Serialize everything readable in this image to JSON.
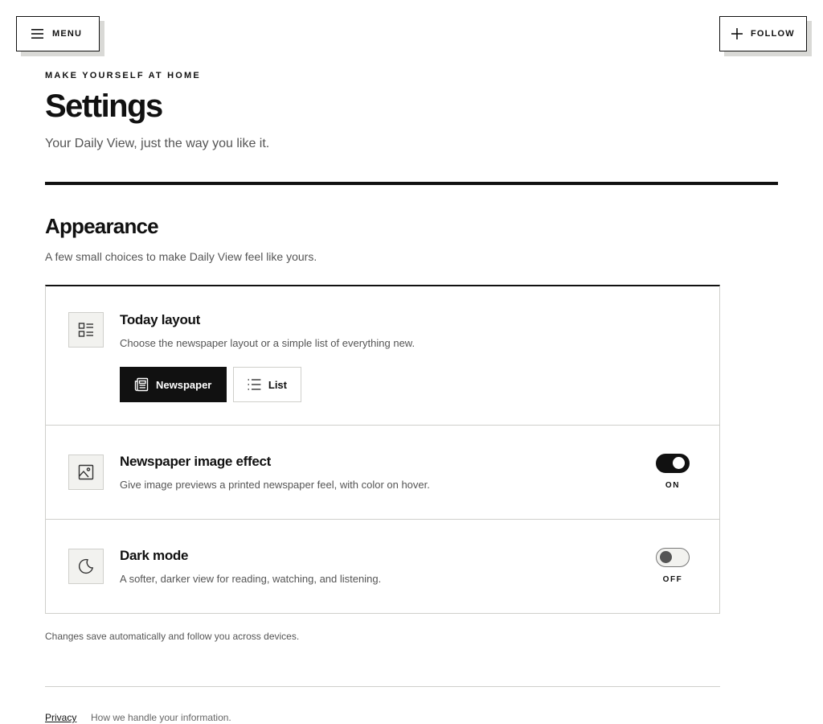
{
  "header": {
    "menu_label": "MENU",
    "follow_label": "FOLLOW"
  },
  "page": {
    "eyebrow": "MAKE YOURSELF AT HOME",
    "title": "Settings",
    "subtitle": "Your Daily View, just the way you like it."
  },
  "appearance": {
    "title": "Appearance",
    "description": "A few small choices to make Daily View feel like yours.",
    "today_layout": {
      "title": "Today layout",
      "description": "Choose the newspaper layout or a simple list of everything new.",
      "options": [
        {
          "label": "Newspaper",
          "selected": true,
          "icon": "newspaper-icon"
        },
        {
          "label": "List",
          "selected": false,
          "icon": "list-icon"
        }
      ],
      "icon": "layout-icon"
    },
    "image_effect": {
      "title": "Newspaper image effect",
      "description": "Give image previews a printed newspaper feel, with color on hover.",
      "state": "ON",
      "enabled": true,
      "icon": "image-icon"
    },
    "dark_mode": {
      "title": "Dark mode",
      "description": "A softer, darker view for reading, watching, and listening.",
      "state": "OFF",
      "enabled": false,
      "icon": "moon-icon"
    }
  },
  "footnote": "Changes save automatically and follow you across devices.",
  "footer": {
    "privacy_label": "Privacy",
    "privacy_note": "How we handle your information."
  },
  "colors": {
    "ink": "#111111",
    "muted": "#555555",
    "border": "#cfcfcb",
    "icon_bg": "#f2f2ef",
    "shadow": "#d9d9d6"
  }
}
